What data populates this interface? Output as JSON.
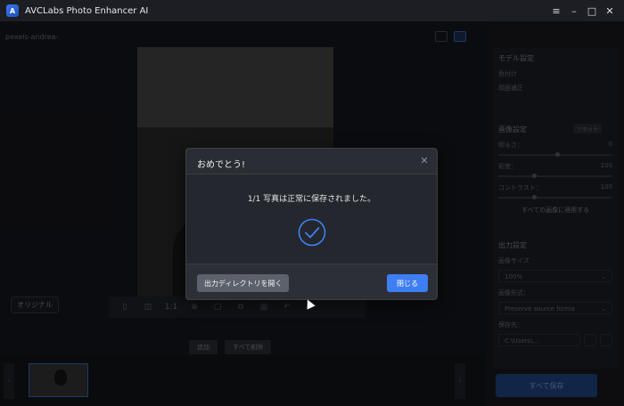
{
  "app": {
    "title": "AVCLabs Photo Enhancer AI",
    "logo_text": "A",
    "window_controls": {
      "menu": "≡",
      "minimize": "–",
      "maximize": "□",
      "close": "✕"
    }
  },
  "file_bar": {
    "file_name": "pexels-andrea-",
    "meta_1": "",
    "meta_2": "",
    "meta_3": ""
  },
  "canvas": {
    "original_label": "オリジナル",
    "right_label": "",
    "toolbar": {
      "zoom_label": "1:1"
    }
  },
  "actions": {
    "add": "追加",
    "clear_all": "すべて削除"
  },
  "panel": {
    "model_settings": {
      "title": "モデル設定",
      "option_1": "色付け",
      "option_2": "顔面補正"
    },
    "image_settings": {
      "title": "画像設定",
      "reset": "リセット",
      "brightness_label": "明るさ：",
      "brightness_value": "0",
      "saturation_label": "彩度：",
      "saturation_value": "100",
      "contrast_label": "コントラスト：",
      "contrast_value": "100",
      "apply_all": "すべての画像に適用する"
    },
    "output_settings": {
      "title": "出力設定",
      "size_label": "画像サイズ",
      "size_value": "100%",
      "format_label": "画像形式：",
      "format_value": "Preserve source forma",
      "save_to_label": "保存先：",
      "save_to_value": "C:\\Users\\..."
    },
    "save_all": "すべて保存"
  },
  "dialog": {
    "title": "おめでとう!",
    "message": "1/1 写真は正常に保存されました。",
    "open_dir_button": "出力ディレクトリを開く",
    "close_button": "閉じる",
    "close_icon": "✕"
  },
  "colors": {
    "accent": "#3d7ef2",
    "dialog_bg": "#24272d",
    "check": "#3d7ef2"
  }
}
